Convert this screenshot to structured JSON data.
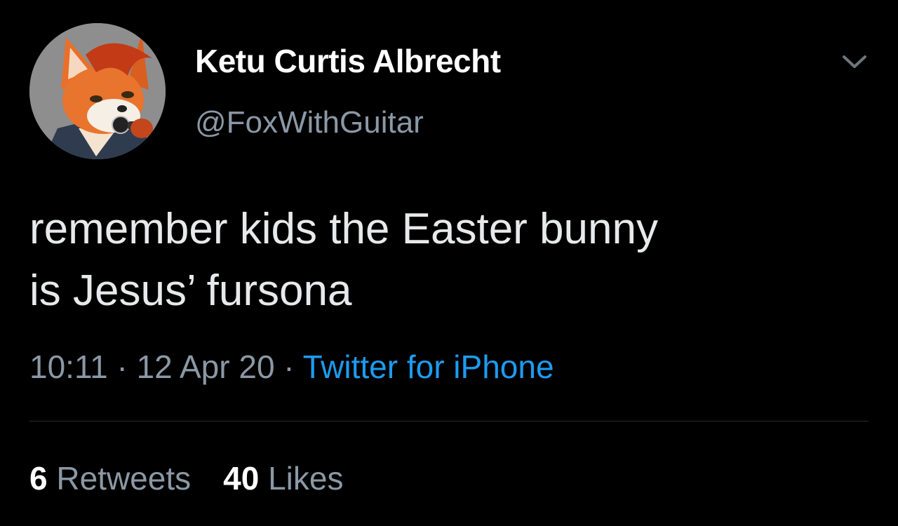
{
  "user": {
    "display_name": "Ketu Curtis Albrecht",
    "handle": "@FoxWithGuitar",
    "avatar_icon": "fox-avatar"
  },
  "tweet": {
    "text_line1": "remember kids the Easter bunny",
    "text_line2": "is Jesus’ fursona"
  },
  "meta": {
    "time": "10:11",
    "sep1": " · ",
    "date": "12 Apr 20",
    "sep2": " · ",
    "source": "Twitter for iPhone"
  },
  "stats": {
    "retweets_count": "6",
    "retweets_label": "Retweets",
    "likes_count": "40",
    "likes_label": "Likes"
  },
  "colors": {
    "background": "#000000",
    "link": "#1d9bf0",
    "secondary": "#8b98a5"
  }
}
